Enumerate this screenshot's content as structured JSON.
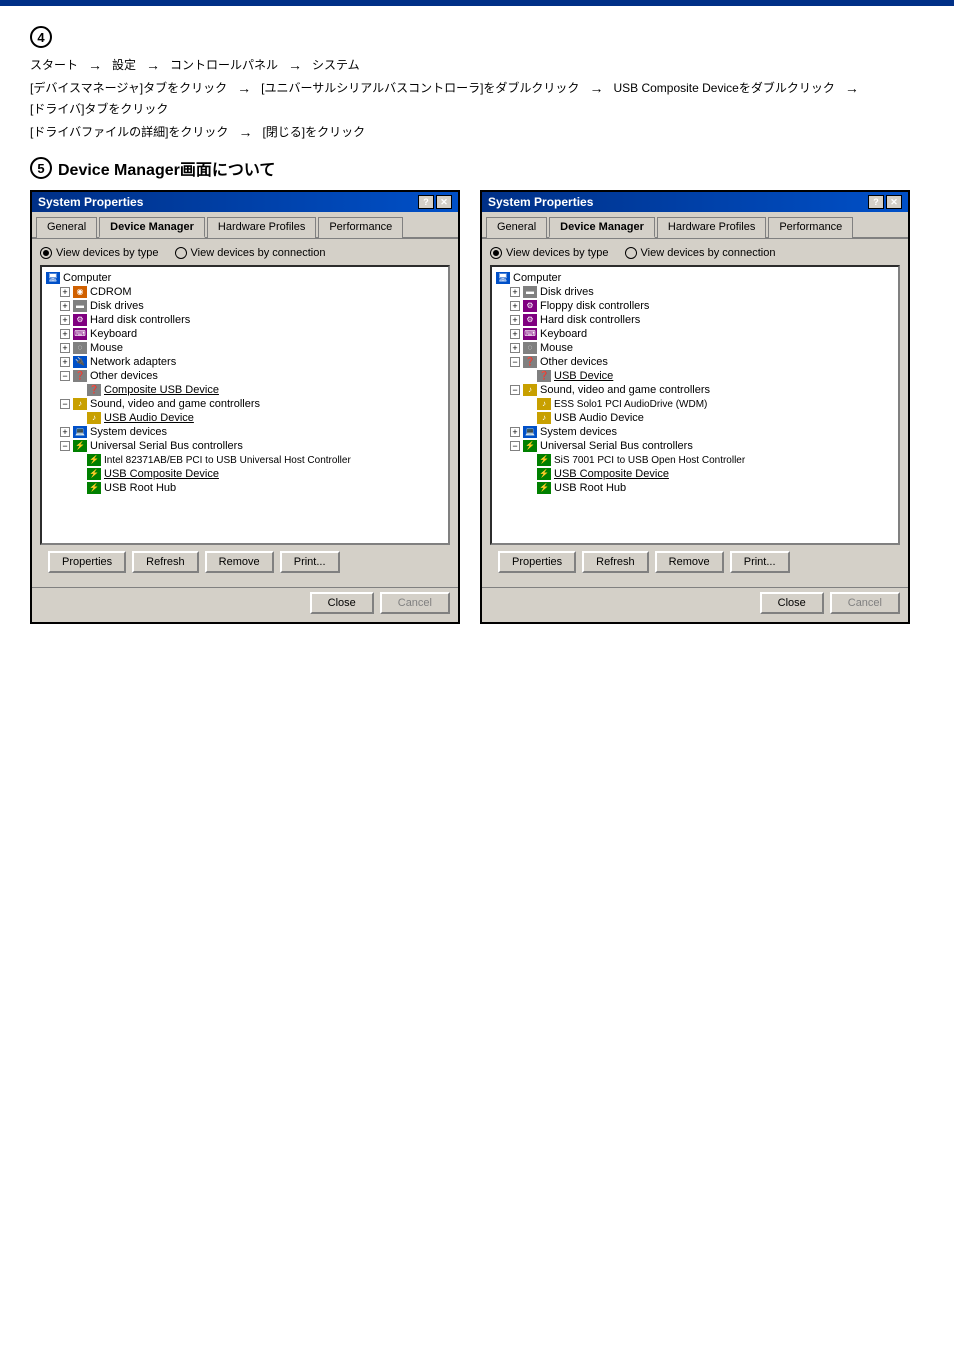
{
  "page": {
    "background": "#ffffff"
  },
  "step4": {
    "number": "④",
    "instructions": [
      {
        "id": "row1",
        "parts": [
          "スタート",
          "設定",
          "コントロールパネル",
          "システム"
        ]
      },
      {
        "id": "row2",
        "parts": [
          "[デバイスマネージャ]タブをクリック",
          "[ユニバーサルシリアルバスコントローラ]をダブルクリック",
          "USB Composite Deviceをダブルクリック",
          "[ドライバ]タブをクリック"
        ]
      },
      {
        "id": "row3",
        "parts": [
          "[ドライバファイルの詳細]をクリック",
          "[閉じる]をクリック"
        ]
      }
    ]
  },
  "step5": {
    "number": "⑤",
    "description": "Device Manager画面について"
  },
  "dialog_left": {
    "title": "System Properties",
    "title_icon": "?x",
    "tabs": [
      "General",
      "Device Manager",
      "Hardware Profiles",
      "Performance"
    ],
    "active_tab": "Device Manager",
    "radio_options": [
      "View devices by type",
      "View devices by connection"
    ],
    "active_radio": 0,
    "tree": [
      {
        "level": 0,
        "expand": "none",
        "icon": "computer",
        "label": "Computer",
        "underlined": false
      },
      {
        "level": 1,
        "expand": "plus",
        "icon": "cdrom",
        "label": "CDROM",
        "underlined": false
      },
      {
        "level": 1,
        "expand": "plus",
        "icon": "disk",
        "label": "Disk drives",
        "underlined": false
      },
      {
        "level": 1,
        "expand": "plus",
        "icon": "hdc",
        "label": "Hard disk controllers",
        "underlined": false
      },
      {
        "level": 1,
        "expand": "plus",
        "icon": "keyboard",
        "label": "Keyboard",
        "underlined": false
      },
      {
        "level": 1,
        "expand": "plus",
        "icon": "mouse",
        "label": "Mouse",
        "underlined": false
      },
      {
        "level": 1,
        "expand": "plus",
        "icon": "network",
        "label": "Network adapters",
        "underlined": false
      },
      {
        "level": 1,
        "expand": "minus",
        "icon": "other",
        "label": "Other devices",
        "underlined": false
      },
      {
        "level": 2,
        "expand": "none",
        "icon": "device",
        "label": "Composite USB Device",
        "underlined": true
      },
      {
        "level": 1,
        "expand": "minus",
        "icon": "sound",
        "label": "Sound, video and game controllers",
        "underlined": false
      },
      {
        "level": 2,
        "expand": "none",
        "icon": "sound",
        "label": "USB Audio Device",
        "underlined": true
      },
      {
        "level": 1,
        "expand": "plus",
        "icon": "system",
        "label": "System devices",
        "underlined": false
      },
      {
        "level": 1,
        "expand": "minus",
        "icon": "usb",
        "label": "Universal Serial Bus controllers",
        "underlined": false
      },
      {
        "level": 2,
        "expand": "none",
        "icon": "usb",
        "label": "Intel 82371AB/EB PCI to USB Universal Host Controller",
        "underlined": false
      },
      {
        "level": 2,
        "expand": "none",
        "icon": "usb",
        "label": "USB Composite Device",
        "underlined": true
      },
      {
        "level": 2,
        "expand": "none",
        "icon": "usb",
        "label": "USB Root Hub",
        "underlined": false
      }
    ],
    "buttons": [
      "Properties",
      "Refresh",
      "Remove",
      "Print..."
    ],
    "close_buttons": [
      "Close",
      "Cancel"
    ]
  },
  "dialog_right": {
    "title": "System Properties",
    "title_icon": "?x",
    "tabs": [
      "General",
      "Device Manager",
      "Hardware Profiles",
      "Performance"
    ],
    "active_tab": "Device Manager",
    "radio_options": [
      "View devices by type",
      "View devices by connection"
    ],
    "active_radio": 0,
    "tree": [
      {
        "level": 0,
        "expand": "none",
        "icon": "computer",
        "label": "Computer",
        "underlined": false
      },
      {
        "level": 1,
        "expand": "plus",
        "icon": "disk",
        "label": "Disk drives",
        "underlined": false
      },
      {
        "level": 1,
        "expand": "plus",
        "icon": "floppy",
        "label": "Floppy disk controllers",
        "underlined": false
      },
      {
        "level": 1,
        "expand": "plus",
        "icon": "hdc",
        "label": "Hard disk controllers",
        "underlined": false
      },
      {
        "level": 1,
        "expand": "plus",
        "icon": "keyboard",
        "label": "Keyboard",
        "underlined": false
      },
      {
        "level": 1,
        "expand": "plus",
        "icon": "mouse",
        "label": "Mouse",
        "underlined": false
      },
      {
        "level": 1,
        "expand": "minus",
        "icon": "other",
        "label": "Other devices",
        "underlined": false
      },
      {
        "level": 2,
        "expand": "none",
        "icon": "device",
        "label": "USB Device",
        "underlined": true
      },
      {
        "level": 1,
        "expand": "minus",
        "icon": "sound",
        "label": "Sound, video and game controllers",
        "underlined": false
      },
      {
        "level": 2,
        "expand": "none",
        "icon": "sound",
        "label": "ESS Solo1 PCI AudioDrive (WDM)",
        "underlined": false
      },
      {
        "level": 2,
        "expand": "none",
        "icon": "sound",
        "label": "USB Audio Device",
        "underlined": false
      },
      {
        "level": 1,
        "expand": "plus",
        "icon": "system",
        "label": "System devices",
        "underlined": false
      },
      {
        "level": 1,
        "expand": "minus",
        "icon": "usb",
        "label": "Universal Serial Bus controllers",
        "underlined": false
      },
      {
        "level": 2,
        "expand": "none",
        "icon": "usb",
        "label": "SiS 7001 PCI to USB Open Host Controller",
        "underlined": false
      },
      {
        "level": 2,
        "expand": "none",
        "icon": "usb",
        "label": "USB Composite Device",
        "underlined": true
      },
      {
        "level": 2,
        "expand": "none",
        "icon": "usb",
        "label": "USB Root Hub",
        "underlined": false
      }
    ],
    "buttons": [
      "Properties",
      "Refresh",
      "Remove",
      "Print..."
    ],
    "close_buttons": [
      "Close",
      "Cancel"
    ]
  }
}
